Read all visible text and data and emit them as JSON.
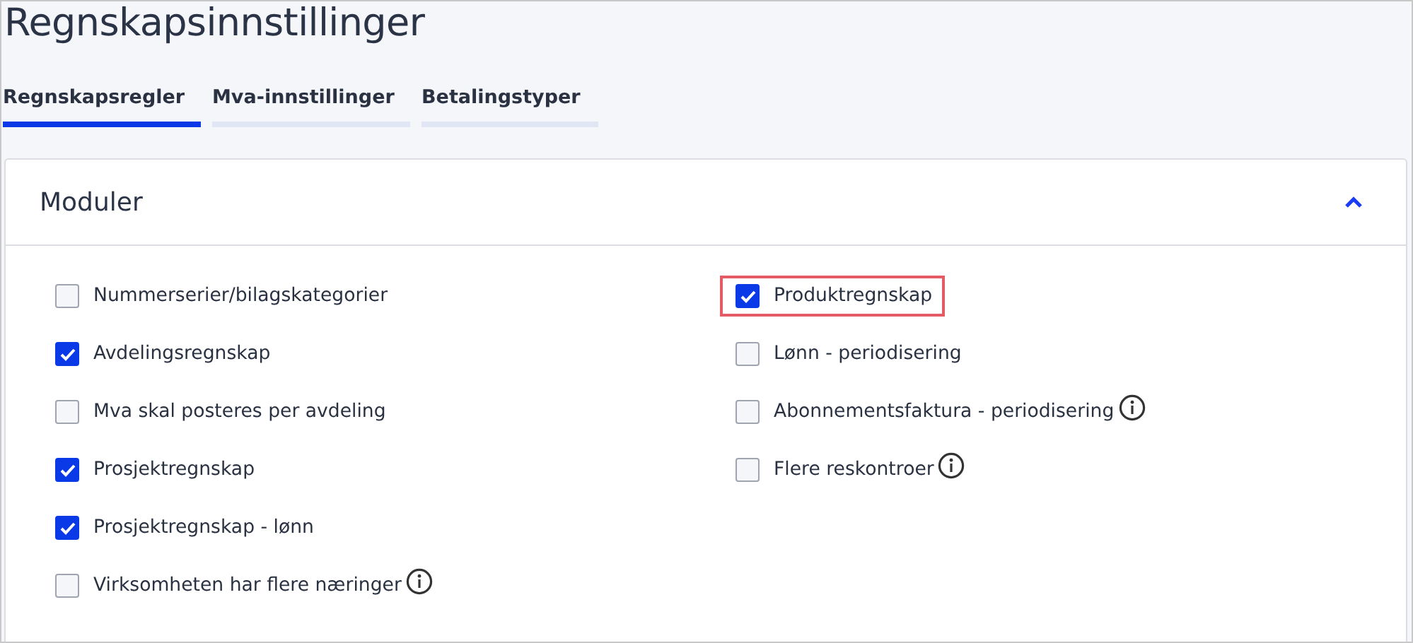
{
  "title": "Regnskapsinnstillinger",
  "tabs": [
    {
      "label": "Regnskapsregler",
      "selected": true
    },
    {
      "label": "Mva-innstillinger",
      "selected": false
    },
    {
      "label": "Betalingstyper",
      "selected": false
    }
  ],
  "section": {
    "title": "Moduler",
    "expanded": true,
    "columns": [
      [
        {
          "label": "Nummerserier/bilagskategorier",
          "checked": false,
          "info": false,
          "highlighted": false
        },
        {
          "label": "Avdelingsregnskap",
          "checked": true,
          "info": false,
          "highlighted": false
        },
        {
          "label": "Mva skal posteres per avdeling",
          "checked": false,
          "info": false,
          "highlighted": false
        },
        {
          "label": "Prosjektregnskap",
          "checked": true,
          "info": false,
          "highlighted": false
        },
        {
          "label": "Prosjektregnskap - lønn",
          "checked": true,
          "info": false,
          "highlighted": false
        },
        {
          "label": "Virksomheten har flere næringer",
          "checked": false,
          "info": true,
          "highlighted": false
        }
      ],
      [
        {
          "label": "Produktregnskap",
          "checked": true,
          "info": false,
          "highlighted": true
        },
        {
          "label": "Lønn - periodisering",
          "checked": false,
          "info": false,
          "highlighted": false
        },
        {
          "label": "Abonnementsfaktura - periodisering",
          "checked": false,
          "info": true,
          "highlighted": false
        },
        {
          "label": "Flere reskontroer",
          "checked": false,
          "info": true,
          "highlighted": false
        }
      ]
    ]
  }
}
